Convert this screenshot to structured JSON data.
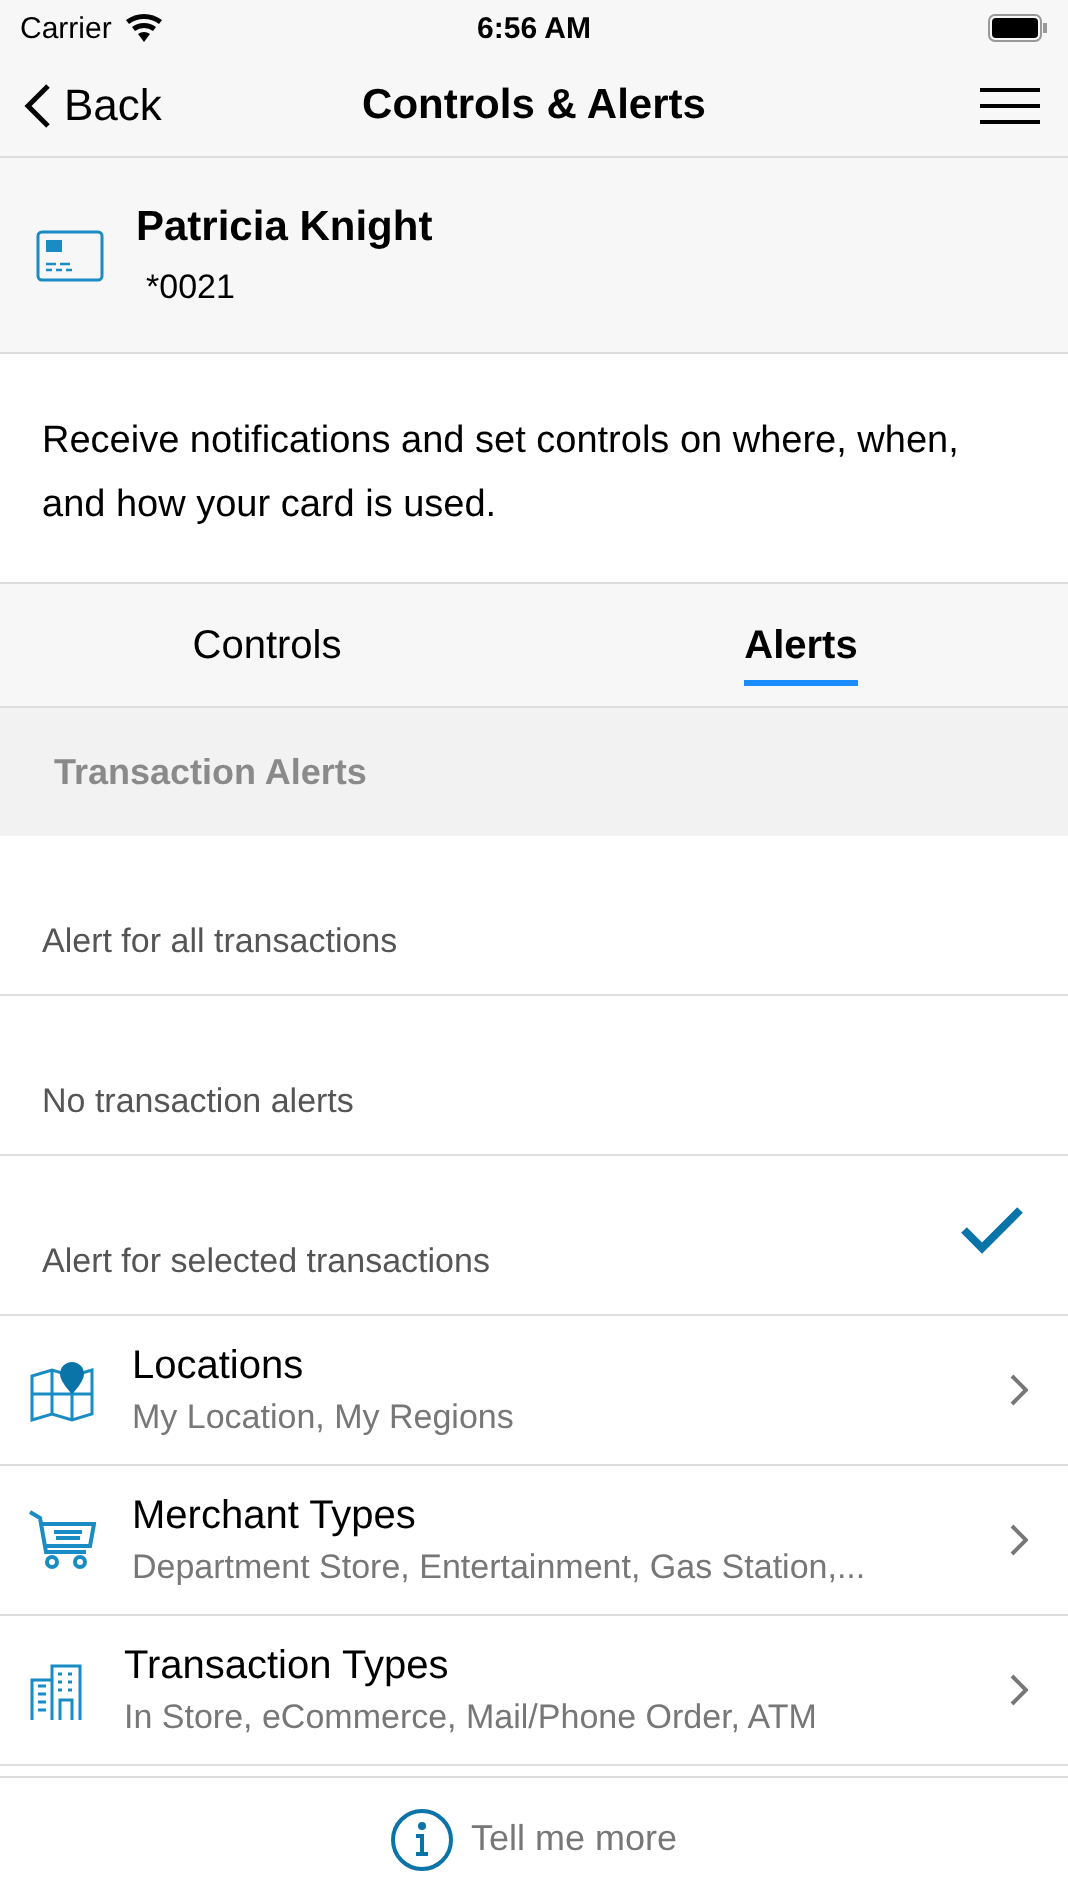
{
  "status_bar": {
    "carrier": "Carrier",
    "time": "6:56 AM"
  },
  "nav": {
    "back": "Back",
    "title": "Controls & Alerts"
  },
  "card": {
    "holder": "Patricia Knight",
    "number": "*0021"
  },
  "description": "Receive notifications and set controls on where, when, and how your card is used.",
  "tabs": [
    {
      "label": "Controls",
      "selected": false
    },
    {
      "label": "Alerts",
      "selected": true
    }
  ],
  "section": {
    "title": "Transaction Alerts"
  },
  "options": [
    {
      "label": "Alert for all transactions",
      "selected": false
    },
    {
      "label": "No transaction alerts",
      "selected": false
    },
    {
      "label": "Alert for selected transactions",
      "selected": true
    }
  ],
  "items": [
    {
      "kind": "map",
      "title": "Locations",
      "subtitle": "My Location, My Regions"
    },
    {
      "kind": "cart",
      "title": "Merchant Types",
      "subtitle": "Department Store, Entertainment, Gas Station,..."
    },
    {
      "kind": "buildings",
      "title": "Transaction Types",
      "subtitle": "In Store, eCommerce, Mail/Phone Order, ATM"
    }
  ],
  "footer": {
    "link": "Tell me more"
  }
}
